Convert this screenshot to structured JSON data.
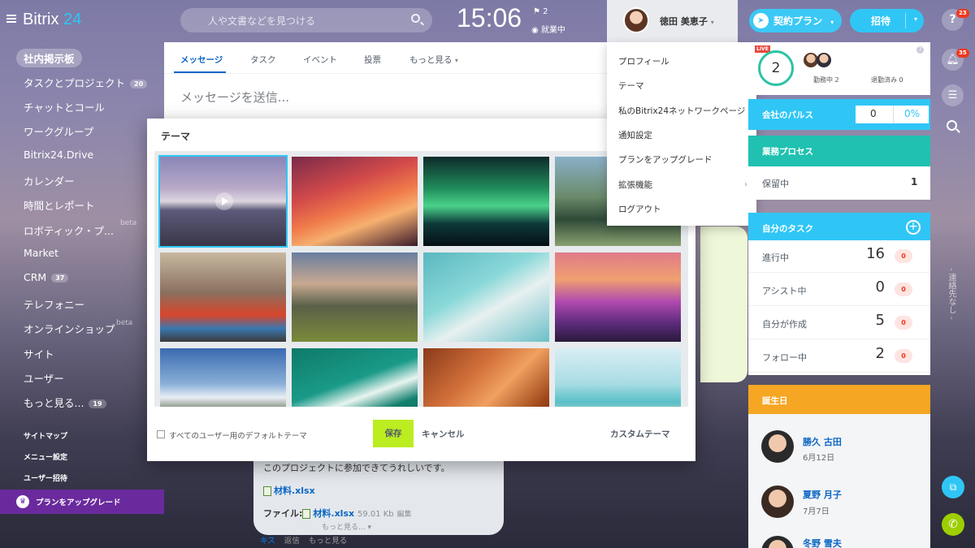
{
  "header": {
    "logo_main": "Bitrix",
    "logo_num": "24",
    "search_placeholder": "人や文書などを見つける",
    "time": "15:06",
    "flag_count": "2",
    "work_status": "就業中",
    "user_name": "徳田 美恵子",
    "plan_button": "契約プラン",
    "invite_button": "招待"
  },
  "left_menu": {
    "items": [
      {
        "label": "社内掲示板"
      },
      {
        "label": "タスクとプロジェクト",
        "count": "20"
      },
      {
        "label": "チャットとコール"
      },
      {
        "label": "ワークグループ"
      },
      {
        "label": "Bitrix24.Drive"
      },
      {
        "label": "カレンダー"
      },
      {
        "label": "時間とレポート"
      },
      {
        "label": "ロボティック・プ...",
        "badge": "beta"
      },
      {
        "label": "Market"
      },
      {
        "label": "CRM",
        "count": "37"
      },
      {
        "label": "テレフォニー"
      },
      {
        "label": "オンラインショップ",
        "badge": "beta"
      },
      {
        "label": "サイト"
      },
      {
        "label": "ユーザー"
      },
      {
        "label": "もっと見る...",
        "count": "19"
      }
    ],
    "sitemap": "サイトマップ",
    "menu_settings": "メニュー設定",
    "invite_users": "ユーザー招待",
    "upgrade": "プランをアップグレード"
  },
  "feed": {
    "tabs": [
      "メッセージ",
      "タスク",
      "イベント",
      "投票",
      "もっと見る"
    ],
    "message_placeholder": "メッセージを送信...",
    "post": {
      "text": "このプロジェクトに参加できてうれしいです。",
      "attachment": "材料.xlsx",
      "file_label": "ファイル:",
      "file_name": "材料.xlsx",
      "file_size": "59.01 Kb",
      "file_edit": "編集",
      "more": "もっと見る...",
      "actions": [
        "キス",
        "返信",
        "もっと見る"
      ]
    }
  },
  "theme_dialog": {
    "title": "テーマ",
    "default_theme_label": "すべてのユーザー用のデフォルトテーマ",
    "save": "保存",
    "cancel": "キャンセル",
    "custom_theme": "カスタムテーマ"
  },
  "user_menu": {
    "items": [
      "プロフィール",
      "テーマ",
      "私のBitrix24ネットワークページ",
      "通知設定",
      "プランをアップグレード",
      "拡張機能",
      "ログアウト"
    ]
  },
  "right_column": {
    "live_badge": "LIVE",
    "working_count": "2",
    "at_work_label": "勤務中",
    "at_work_count": "2",
    "left_work_label": "退勤済み",
    "left_work_count": "0",
    "pulse_label": "会社のパルス",
    "pulse_value": "0",
    "pulse_percent": "0%",
    "workflow_label": "業務プロセス",
    "pending_label": "保留中",
    "pending_count": "1",
    "my_tasks_label": "自分のタスク",
    "tasks": [
      {
        "label": "進行中",
        "value": "16",
        "badge": "0"
      },
      {
        "label": "アシスト中",
        "value": "0",
        "badge": "0"
      },
      {
        "label": "自分が作成",
        "value": "5",
        "badge": "0"
      },
      {
        "label": "フォロー中",
        "value": "2",
        "badge": "0"
      }
    ],
    "birthdays_label": "誕生日",
    "birthdays": [
      {
        "name": "勝久 古田",
        "date": "6月12日"
      },
      {
        "name": "夏野 月子",
        "date": "7月7日"
      },
      {
        "name": "冬野 雪夫",
        "date": ""
      }
    ]
  },
  "far_right": {
    "help_badge": "23",
    "notify_badge": "35",
    "no_contacts": "- 連絡先なし -"
  },
  "colors": {
    "accent": "#2fc6f6",
    "save_green": "#bbed21",
    "pulse_blue": "#2fc6f6",
    "workflow_teal": "#20c1b0",
    "birthday_orange": "#f5a623",
    "upgrade_purple": "#6a2a9e",
    "badge_red": "#f0371b"
  },
  "icons": [
    "menu-icon",
    "search-icon",
    "flag-icon",
    "clock-icon",
    "rocket-icon",
    "chevron-down-icon",
    "help-icon",
    "bell-icon",
    "chat-icon",
    "phone-icon",
    "crown-icon",
    "plus-icon",
    "play-icon",
    "file-xlsx-icon"
  ]
}
